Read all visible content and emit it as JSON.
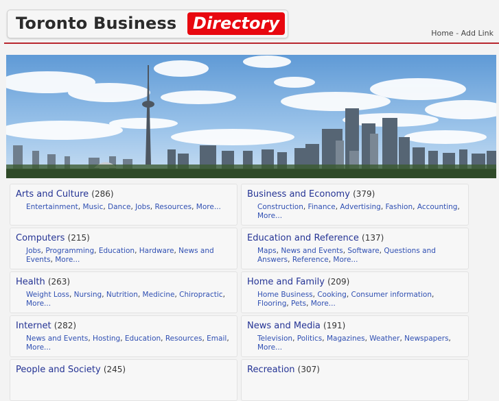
{
  "header": {
    "brand_main": "Toronto Business",
    "brand_highlight": "Directory",
    "nav": {
      "home": "Home",
      "separator": " - ",
      "add_link": "Add Link"
    }
  },
  "colors": {
    "accent_red": "#e8070f",
    "link_blue": "#2f4fb2",
    "title_blue": "#243394",
    "rule": "#b8252d"
  },
  "categories": [
    {
      "title": "Arts and Culture",
      "count": "(286)",
      "subs": [
        "Entertainment",
        "Music",
        "Dance",
        "Jobs",
        "Resources",
        "More..."
      ]
    },
    {
      "title": "Business and Economy",
      "count": "(379)",
      "subs": [
        "Construction",
        "Finance",
        "Advertising",
        "Fashion",
        "Accounting",
        "More..."
      ]
    },
    {
      "title": "Computers",
      "count": "(215)",
      "subs": [
        "Jobs",
        "Programming",
        "Education",
        "Hardware",
        "News and Events",
        "More..."
      ]
    },
    {
      "title": "Education and Reference",
      "count": "(137)",
      "subs": [
        "Maps",
        "News and Events",
        "Software",
        "Questions and Answers",
        "Reference",
        "More..."
      ]
    },
    {
      "title": "Health",
      "count": "(263)",
      "subs": [
        "Weight Loss",
        "Nursing",
        "Nutrition",
        "Medicine",
        "Chiropractic",
        "More..."
      ]
    },
    {
      "title": "Home and Family",
      "count": "(209)",
      "subs": [
        "Home Business",
        "Cooking",
        "Consumer information",
        "Flooring",
        "Pets",
        "More..."
      ]
    },
    {
      "title": "Internet",
      "count": "(282)",
      "subs": [
        "News and Events",
        "Hosting",
        "Education",
        "Resources",
        "Email",
        "More..."
      ]
    },
    {
      "title": "News and Media",
      "count": "(191)",
      "subs": [
        "Television",
        "Politics",
        "Magazines",
        "Weather",
        "Newspapers",
        "More..."
      ]
    },
    {
      "title": "People and Society",
      "count": "(245)",
      "subs": []
    },
    {
      "title": "Recreation",
      "count": "(307)",
      "subs": []
    }
  ]
}
